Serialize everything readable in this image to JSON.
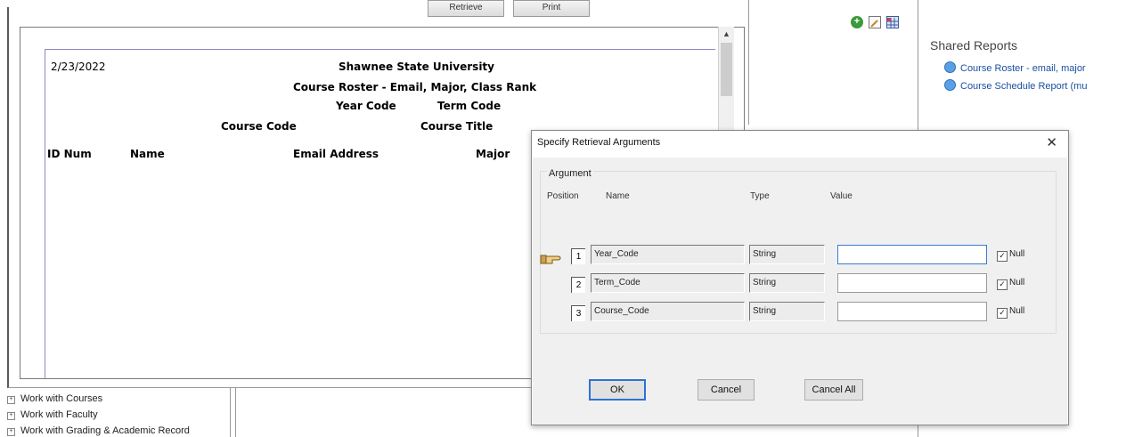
{
  "toolbar": {
    "retrieve_label": "Retrieve",
    "print_label": "Print"
  },
  "report": {
    "date": "2/23/2022",
    "university": "Shawnee State University",
    "title": "Course Roster - Email, Major, Class Rank",
    "year_code_label": "Year Code",
    "term_code_label": "Term Code",
    "course_code_label": "Course Code",
    "course_title_label": "Course Title",
    "columns": [
      "ID Num",
      "Name",
      "Email Address",
      "Major"
    ]
  },
  "shared_reports": {
    "title": "Shared Reports",
    "items": [
      "Course Roster - email, major",
      "Course Schedule Report (mu"
    ]
  },
  "tree": {
    "items": [
      "Work with Courses",
      "Work with Faculty",
      "Work with Grading & Academic Record"
    ]
  },
  "dialog": {
    "title": "Specify Retrieval Arguments",
    "group_label": "Argument",
    "headers": {
      "position": "Position",
      "name": "Name",
      "type": "Type",
      "value": "Value"
    },
    "rows": [
      {
        "position": "1",
        "name": "Year_Code",
        "type": "String",
        "value": "",
        "null_label": "Null",
        "null_checked": true
      },
      {
        "position": "2",
        "name": "Term_Code",
        "type": "String",
        "value": "",
        "null_label": "Null",
        "null_checked": true
      },
      {
        "position": "3",
        "name": "Course_Code",
        "type": "String",
        "value": "",
        "null_label": "Null",
        "null_checked": true
      }
    ],
    "buttons": {
      "ok": "OK",
      "cancel": "Cancel",
      "cancel_all": "Cancel All"
    }
  },
  "colors": {
    "link": "#1a4fa0",
    "focus": "#3a7bd5",
    "add_icon": "#3a9a3a"
  }
}
